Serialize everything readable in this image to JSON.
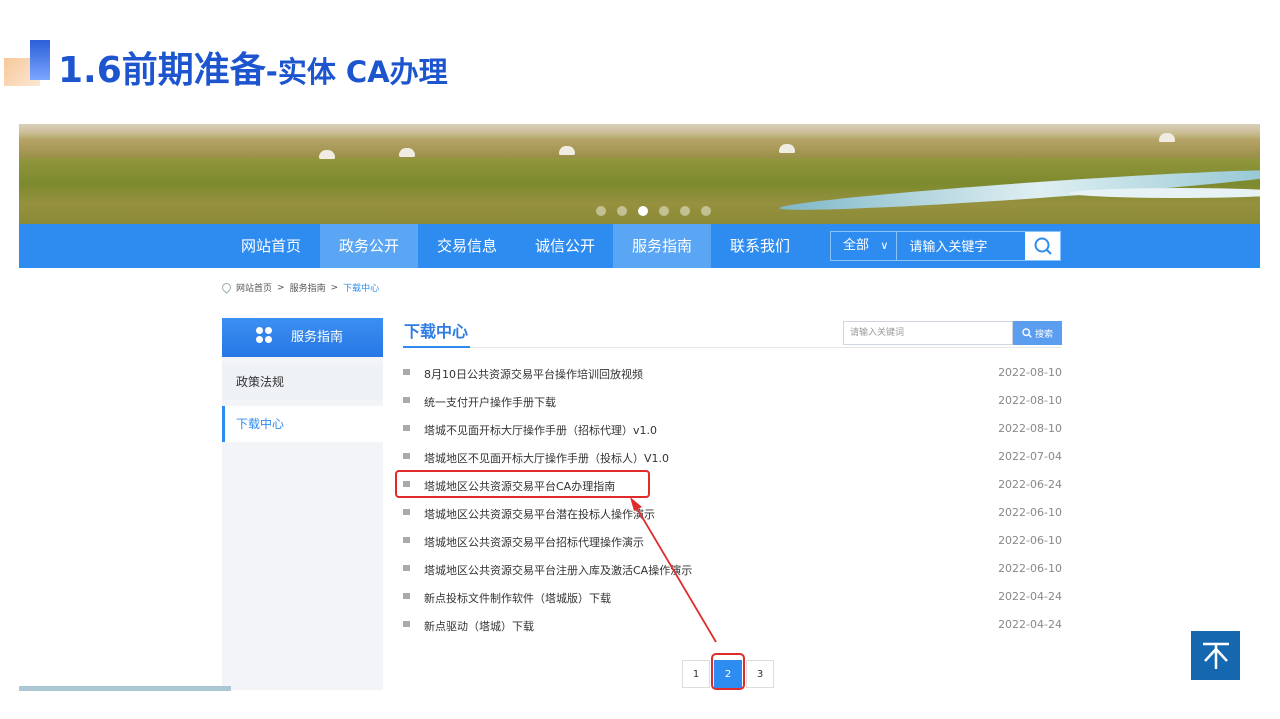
{
  "slide": {
    "title_main": "1.6前期准备",
    "title_sub": "-实体 CA办理"
  },
  "nav": {
    "items": [
      {
        "label": "网站首页",
        "active": false
      },
      {
        "label": "政务公开",
        "active": true
      },
      {
        "label": "交易信息",
        "active": false
      },
      {
        "label": "诚信公开",
        "active": false
      },
      {
        "label": "服务指南",
        "active": true
      },
      {
        "label": "联系我们",
        "active": false
      }
    ],
    "scope": "全部",
    "search_placeholder": "请输入关键字"
  },
  "breadcrumb": {
    "home": "网站首页",
    "sep1": ">",
    "section": "服务指南",
    "sep2": ">",
    "current": "下载中心"
  },
  "sidebar": {
    "title": "服务指南",
    "items": [
      {
        "label": "政策法规"
      },
      {
        "label": "下载中心"
      }
    ]
  },
  "content": {
    "title": "下载中心",
    "search_placeholder": "请输入关键词",
    "search_button": "搜索",
    "rows": [
      {
        "title": "8月10日公共资源交易平台操作培训回放视频",
        "date": "2022-08-10"
      },
      {
        "title": "统一支付开户操作手册下载",
        "date": "2022-08-10"
      },
      {
        "title": "塔城不见面开标大厅操作手册（招标代理）v1.0",
        "date": "2022-08-10"
      },
      {
        "title": "塔城地区不见面开标大厅操作手册（投标人）V1.0",
        "date": "2022-07-04"
      },
      {
        "title": "塔城地区公共资源交易平台CA办理指南",
        "date": "2022-06-24"
      },
      {
        "title": "塔城地区公共资源交易平台潜在投标人操作演示",
        "date": "2022-06-10"
      },
      {
        "title": "塔城地区公共资源交易平台招标代理操作演示",
        "date": "2022-06-10"
      },
      {
        "title": "塔城地区公共资源交易平台注册入库及激活CA操作演示",
        "date": "2022-06-10"
      },
      {
        "title": "新点投标文件制作软件（塔城版）下载",
        "date": "2022-04-24"
      },
      {
        "title": "新点驱动（塔城）下载",
        "date": "2022-04-24"
      }
    ],
    "pages": [
      "1",
      "2",
      "3"
    ],
    "current_page": "2"
  },
  "colors": {
    "accent": "#2e8cf0",
    "highlight": "#e02b2b",
    "title": "#1d55cf"
  }
}
